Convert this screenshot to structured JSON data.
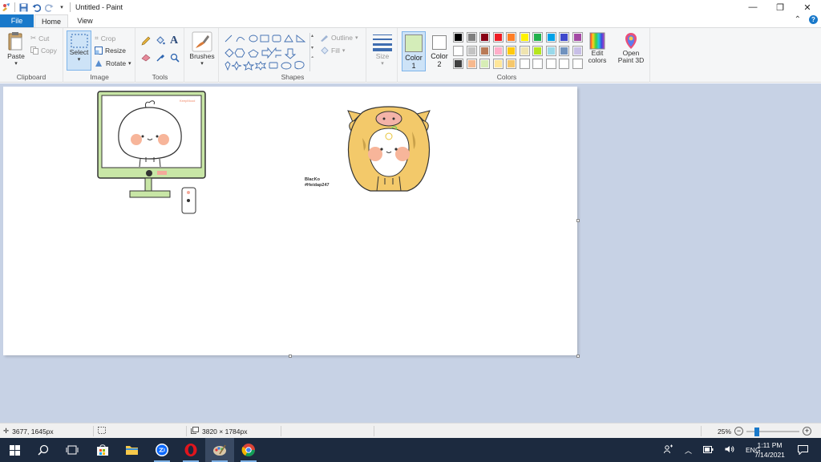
{
  "window": {
    "title": "Untitled - Paint",
    "minimize_glyph": "—",
    "maximize_glyph": "❐",
    "close_glyph": "✕"
  },
  "tabs": {
    "file": "File",
    "home": "Home",
    "view": "View"
  },
  "ribbon": {
    "clipboard": {
      "label": "Clipboard",
      "paste": "Paste",
      "cut": "Cut",
      "copy": "Copy"
    },
    "image": {
      "label": "Image",
      "select": "Select",
      "crop": "Crop",
      "resize": "Resize",
      "rotate": "Rotate"
    },
    "tools": {
      "label": "Tools"
    },
    "brushes": {
      "label": "Brushes"
    },
    "shapes": {
      "label": "Shapes",
      "outline": "Outline",
      "fill": "Fill"
    },
    "size": {
      "label": "Size"
    },
    "colors": {
      "label": "Colors",
      "color1": "Color",
      "color1_num": "1",
      "color2": "Color",
      "color2_num": "2",
      "color1_value": "#d4edb9",
      "color2_value": "#ffffff",
      "edit": "Edit colors",
      "paint3d": "Open Paint 3D",
      "palette": [
        "#000000",
        "#7f7f7f",
        "#880015",
        "#ed1c24",
        "#ff7f27",
        "#fff200",
        "#22b14c",
        "#00a2e8",
        "#3f48cc",
        "#a349a4",
        "#ffffff",
        "#c3c3c3",
        "#b97a57",
        "#ffaec9",
        "#ffc90e",
        "#efe4b0",
        "#b5e61d",
        "#99d9ea",
        "#7092be",
        "#c8bfe7",
        "#404040",
        "#f7b98e",
        "#d7edb6",
        "#ffe699",
        "#f5c76b",
        "#ffffff",
        "#ffffff",
        "#ffffff",
        "#ffffff",
        "#ffffff"
      ]
    }
  },
  "canvas": {
    "sticker_text_1": "BlacKo",
    "sticker_text_2": "#Heidap247",
    "monitor_brand": "KeepMood"
  },
  "status": {
    "cursor_position": "3677, 1645px",
    "image_size": "3820 × 1784px",
    "zoom": "25%",
    "zoom_level": 0.25
  },
  "taskbar": {
    "apps": [
      "start",
      "search",
      "task-view",
      "store",
      "file-explorer",
      "zalo",
      "opera",
      "paint",
      "chrome"
    ],
    "lang": "ENG",
    "time": "1:11 PM",
    "date": "7/14/2021"
  }
}
